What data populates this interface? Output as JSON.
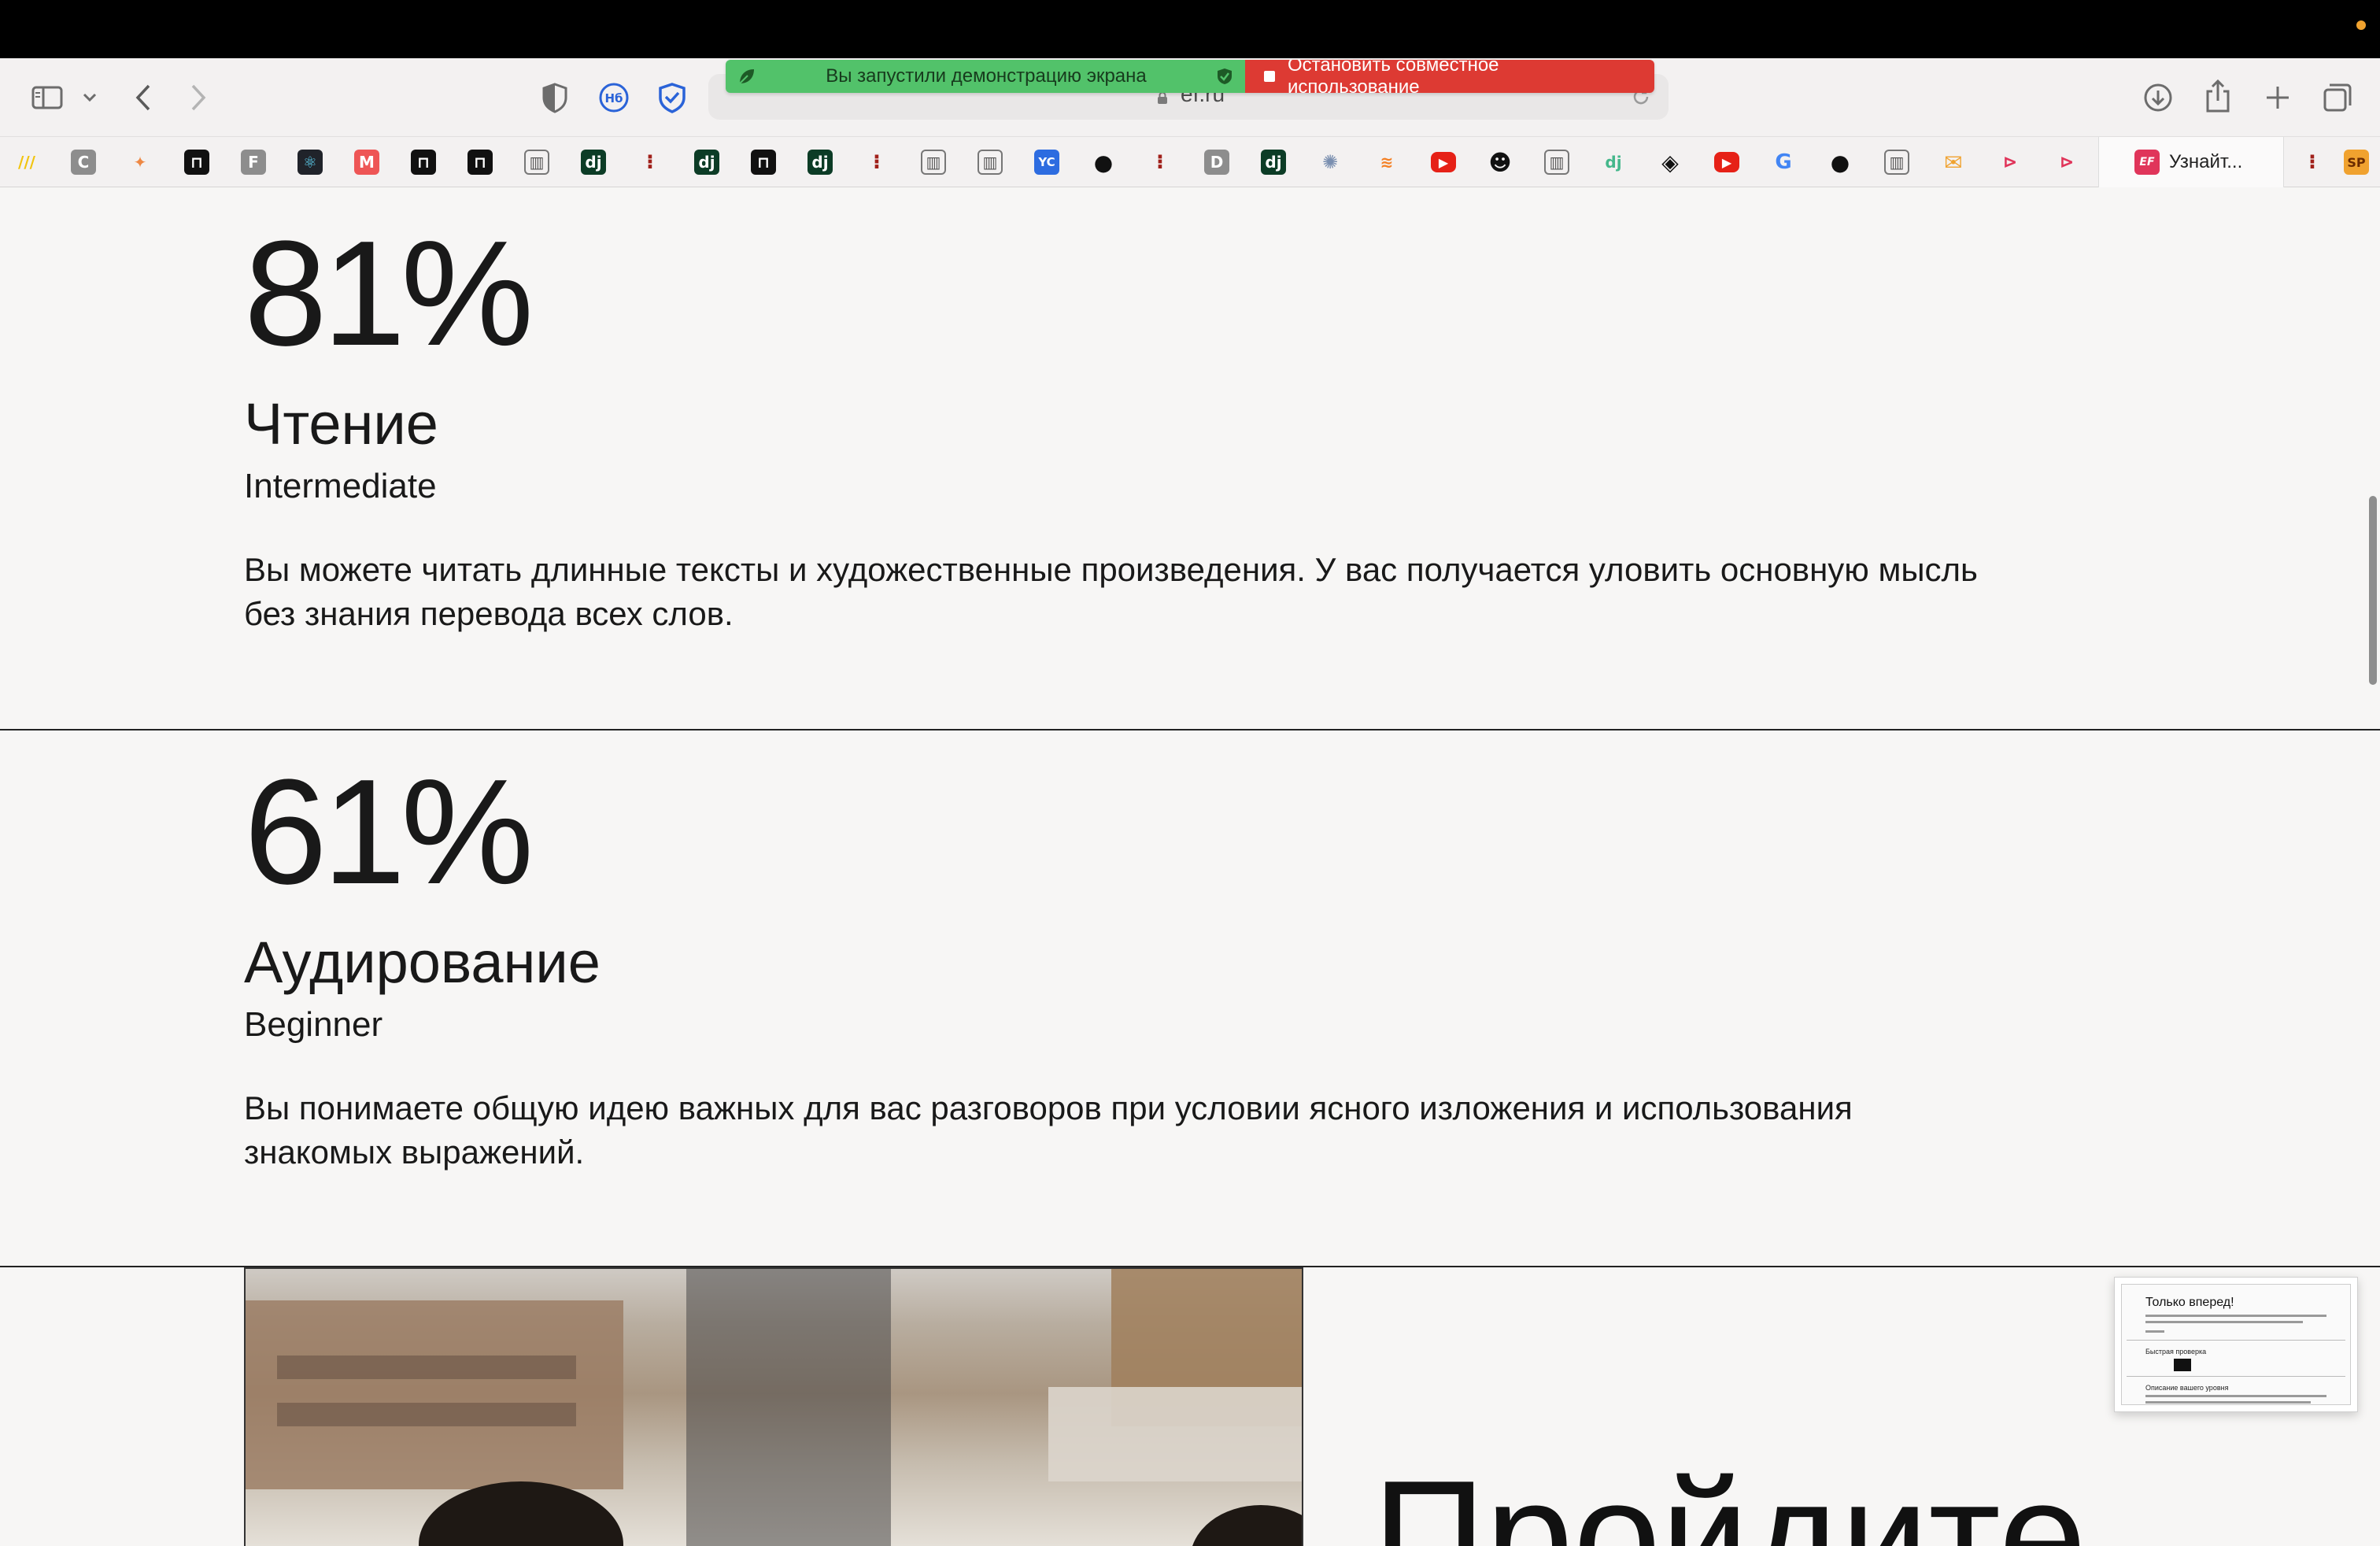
{
  "browser": {
    "url": "ef.ru",
    "share_banner": {
      "started_text": "Вы запустили демонстрацию экрана",
      "stop_text": "Остановить совместное использование",
      "green": "#52c26a",
      "red": "#dd3a33"
    },
    "bookmarks": {
      "last_label": "Узнайт..."
    }
  },
  "skills": [
    {
      "percent": "81%",
      "name": "Чтение",
      "level": "Intermediate",
      "description_line1": "Вы можете читать длинные тексты и художественные произведения. У вас получается уловить основную мысль",
      "description_line2": "без знания перевода всех слов."
    },
    {
      "percent": "61%",
      "name": "Аудирование",
      "level": "Beginner",
      "description_line1": "Вы понимаете общую идею важных для вас разговоров при условии ясного изложения и использования",
      "description_line2": "знакомых выражений."
    }
  ],
  "cta": {
    "title": "Пройдите"
  },
  "thumbnail": {
    "title": "Только вперед!",
    "section1": "Быстрая проверка",
    "section2": "Описание вашего уровня"
  }
}
